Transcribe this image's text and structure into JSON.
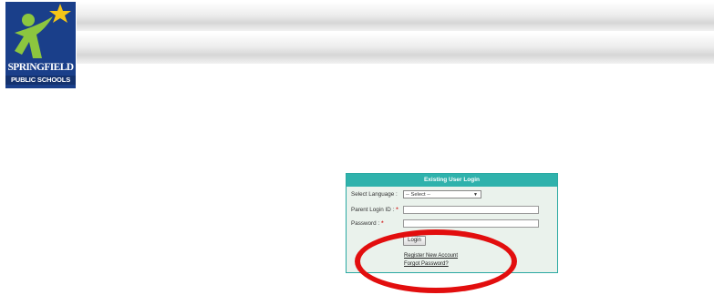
{
  "logo": {
    "name_line1": "SPRINGFIELD",
    "name_line2": "PUBLIC SCHOOLS",
    "icon": "figure-with-star-icon",
    "colors": {
      "background": "#1a3f8a",
      "figure": "#8cc63f",
      "star": "#f5c518"
    }
  },
  "login": {
    "title": "Existing User Login",
    "language_label": "Select Language :",
    "language_selected": "-- Select --",
    "parent_login_label": "Parent Login ID :",
    "parent_login_value": "",
    "password_label": "Password :",
    "password_value": "",
    "required_marker": "*",
    "login_button": "Login",
    "register_link": "Register New Account",
    "forgot_link": "Forgot Password?",
    "colors": {
      "header": "#2fb2ac",
      "panel": "#eaf2ec",
      "required": "#d22020"
    }
  },
  "annotation": {
    "color": "#e20e0e",
    "shape": "ellipse"
  }
}
